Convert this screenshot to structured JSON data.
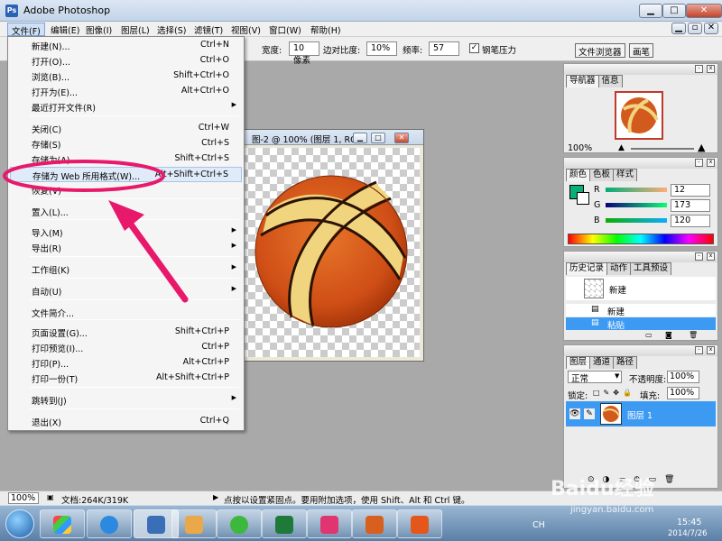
{
  "window": {
    "title": "Adobe Photoshop"
  },
  "menubar": [
    {
      "label": "文件(F)"
    },
    {
      "label": "编辑(E)"
    },
    {
      "label": "图像(I)"
    },
    {
      "label": "图层(L)"
    },
    {
      "label": "选择(S)"
    },
    {
      "label": "滤镜(T)"
    },
    {
      "label": "视图(V)"
    },
    {
      "label": "窗口(W)"
    },
    {
      "label": "帮助(H)"
    }
  ],
  "options": {
    "width_label": "宽度:",
    "width_value": "10 像素",
    "edge_label": "边对比度:",
    "edge_value": "10%",
    "freq_label": "频率:",
    "freq_value": "57",
    "pen_label": "钢笔压力",
    "tab_browser": "文件浏览器",
    "tab_brush": "画笔"
  },
  "file_menu": [
    {
      "label": "新建(N)...",
      "shortcut": "Ctrl+N"
    },
    {
      "label": "打开(O)...",
      "shortcut": "Ctrl+O"
    },
    {
      "label": "浏览(B)...",
      "shortcut": "Shift+Ctrl+O"
    },
    {
      "label": "打开为(E)...",
      "shortcut": "Alt+Ctrl+O"
    },
    {
      "label": "最近打开文件(R)",
      "shortcut": ""
    },
    {
      "label": "关闭(C)",
      "shortcut": "Ctrl+W"
    },
    {
      "label": "存储(S)",
      "shortcut": "Ctrl+S"
    },
    {
      "label": "存储为(A)...",
      "shortcut": "Shift+Ctrl+S"
    },
    {
      "label": "存储为 Web 所用格式(W)...",
      "shortcut": "Alt+Shift+Ctrl+S"
    },
    {
      "label": "恢复(V)",
      "shortcut": ""
    },
    {
      "label": "置入(L)...",
      "shortcut": ""
    },
    {
      "label": "导入(M)",
      "shortcut": ""
    },
    {
      "label": "导出(R)",
      "shortcut": ""
    },
    {
      "label": "工作组(K)",
      "shortcut": ""
    },
    {
      "label": "自动(U)",
      "shortcut": ""
    },
    {
      "label": "文件简介...",
      "shortcut": ""
    },
    {
      "label": "页面设置(G)...",
      "shortcut": "Shift+Ctrl+P"
    },
    {
      "label": "打印预览(I)...",
      "shortcut": "Ctrl+P"
    },
    {
      "label": "打印(P)...",
      "shortcut": "Alt+Ctrl+P"
    },
    {
      "label": "打印一份(T)",
      "shortcut": "Alt+Shift+Ctrl+P"
    },
    {
      "label": "跳转到(J)",
      "shortcut": ""
    },
    {
      "label": "退出(X)",
      "shortcut": "Ctrl+Q"
    }
  ],
  "doc": {
    "title": "图-2 @ 100% (图层 1, RG..."
  },
  "navigator": {
    "tabs": [
      "导航器",
      "信息"
    ],
    "zoom": "100%"
  },
  "color": {
    "tabs": [
      "颜色",
      "色板",
      "样式"
    ],
    "r_label": "R",
    "r": "12",
    "g_label": "G",
    "g": "173",
    "b_label": "B",
    "b": "120",
    "swatch": "#0cad78"
  },
  "history": {
    "tabs": [
      "历史记录",
      "动作",
      "工具预设"
    ],
    "snapshot": "新建",
    "items": [
      "新建",
      "粘贴"
    ]
  },
  "layers": {
    "tabs": [
      "图层",
      "通道",
      "路径"
    ],
    "blend": "正常",
    "opacity_label": "不透明度:",
    "opacity": "100%",
    "lock_label": "锁定:",
    "fill_label": "填充:",
    "fill": "100%",
    "layer_name": "图层 1"
  },
  "status": {
    "zoom": "100%",
    "doc": "文档:264K/319K",
    "hint": "点按以设置紧固点。要用附加选项，使用 Shift、Alt 和 Ctrl 键。"
  },
  "taskbar": {
    "tray_lang": "CH",
    "time": "15:45",
    "date": "2014/7/26",
    "watermark": "Baidu经验",
    "watermark_url": "jingyan.baidu.com"
  },
  "colors": {
    "accent": "#e8196b",
    "selection": "#3d9af2"
  }
}
